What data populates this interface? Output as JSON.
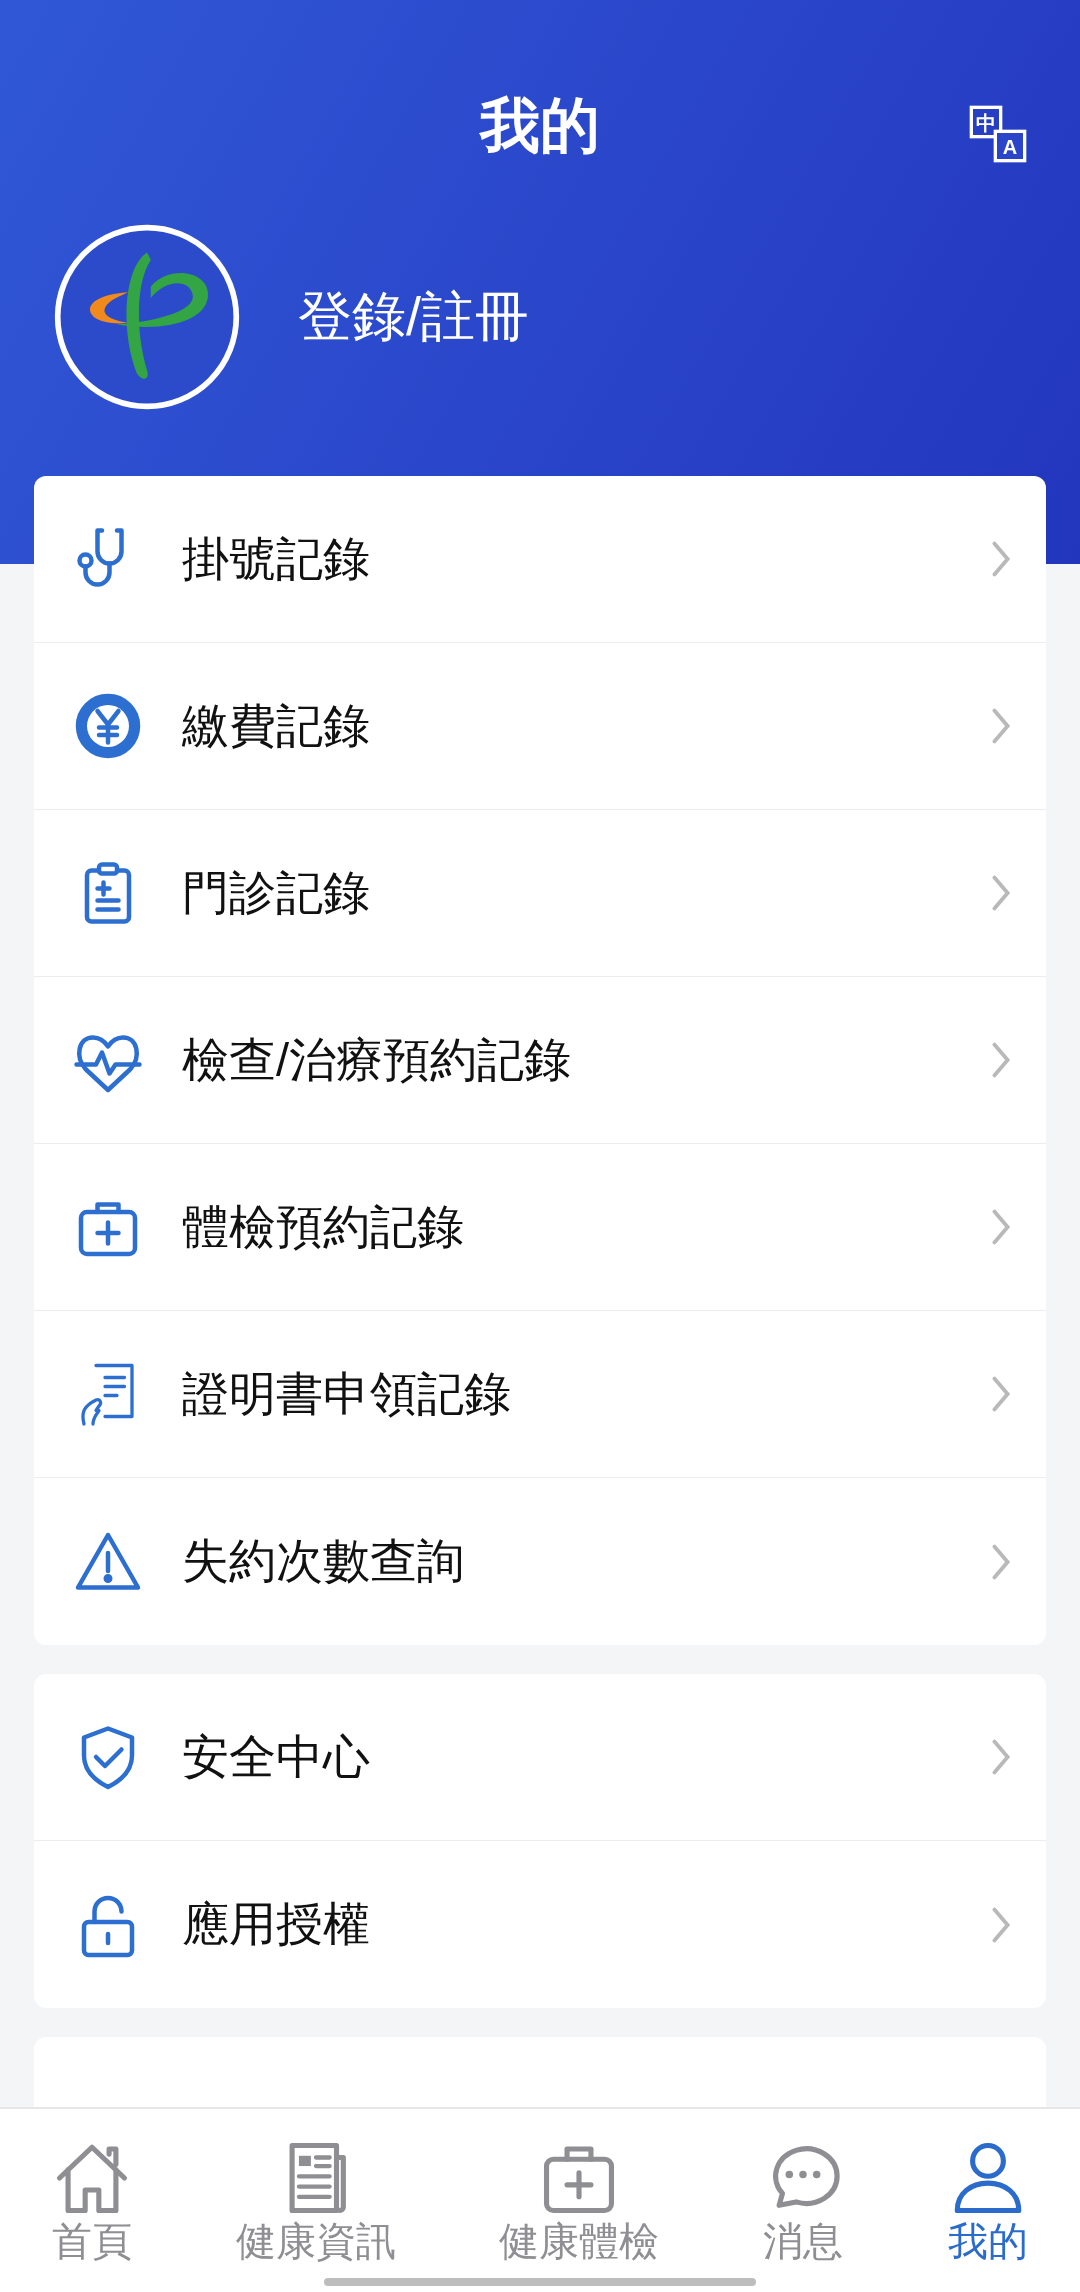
{
  "header": {
    "title": "我的",
    "language_button": [
      "中",
      "A"
    ],
    "login": "登錄/註冊"
  },
  "menu_groups": [
    {
      "items": [
        {
          "label": "掛號記錄"
        },
        {
          "label": "繳費記錄"
        },
        {
          "label": "門診記錄"
        },
        {
          "label": "檢查/治療預約記錄"
        },
        {
          "label": "體檢預約記錄"
        },
        {
          "label": "證明書申領記錄"
        },
        {
          "label": "失約次數查詢"
        }
      ]
    },
    {
      "items": [
        {
          "label": "安全中心"
        },
        {
          "label": "應用授權"
        }
      ]
    }
  ],
  "tab_bar": [
    {
      "label": "首頁",
      "selected": false
    },
    {
      "label": "健康資訊",
      "selected": false
    },
    {
      "label": "健康體檢",
      "selected": false
    },
    {
      "label": "消息",
      "selected": false
    },
    {
      "label": "我的",
      "selected": true
    }
  ]
}
